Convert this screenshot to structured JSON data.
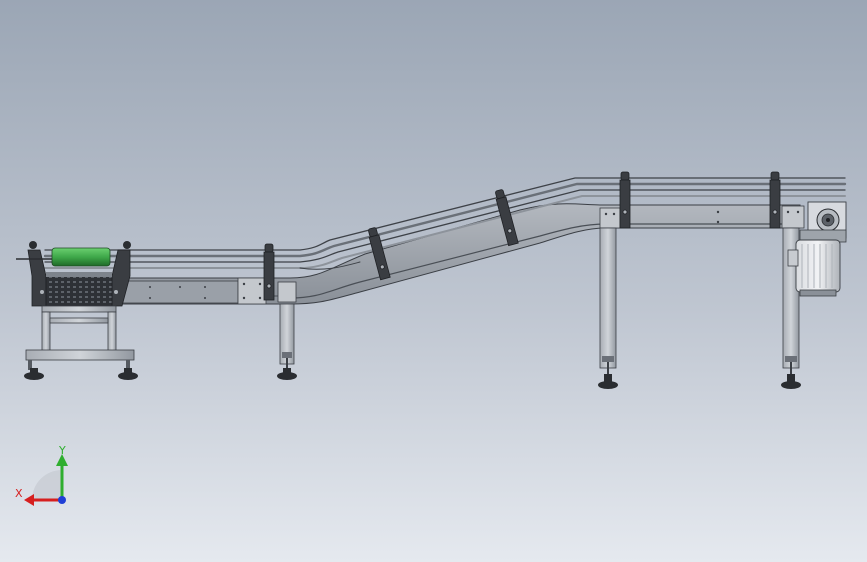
{
  "triad": {
    "x_label": "X",
    "y_label": "Y",
    "colors": {
      "x": "#d61f1f",
      "y": "#2fae2f",
      "z": "#1f3fd6"
    }
  },
  "colors": {
    "background_top": "#9ba6b5",
    "background_bottom": "#e5e9ef",
    "frame": "#8e949c",
    "rail": "#5c6168",
    "bracket": "#3a3d42",
    "roller": "#3fa84a"
  }
}
